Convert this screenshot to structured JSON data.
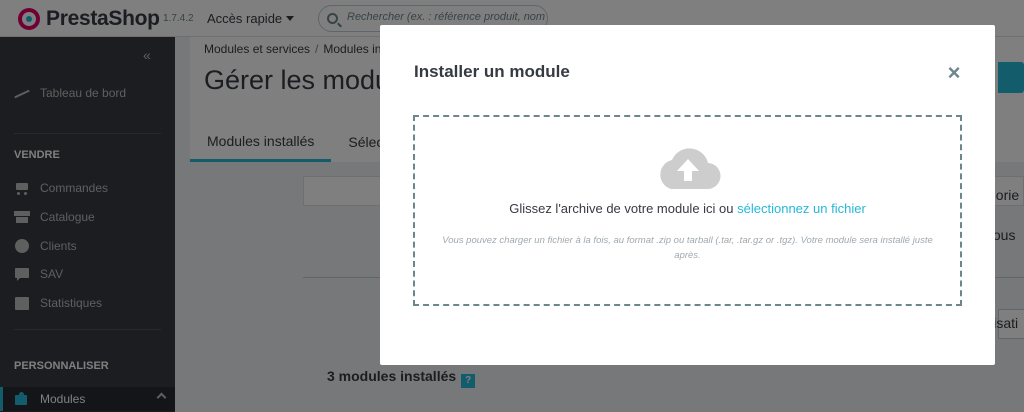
{
  "header": {
    "brand": "PrestaShop",
    "version": "1.7.4.2",
    "quick_access": "Accès rapide",
    "search_placeholder": "Rechercher (ex. : référence produit, nom"
  },
  "sidebar": {
    "collapse": "«",
    "dashboard": "Tableau de bord",
    "section_sell": "VENDRE",
    "sell_items": [
      {
        "label": "Commandes",
        "icon": "cart-icon"
      },
      {
        "label": "Catalogue",
        "icon": "store-icon"
      },
      {
        "label": "Clients",
        "icon": "person-icon"
      },
      {
        "label": "SAV",
        "icon": "chat-icon"
      },
      {
        "label": "Statistiques",
        "icon": "stats-icon"
      }
    ],
    "section_customize": "PERSONNALISER",
    "active_item": {
      "label": "Modules",
      "icon": "puzzle-icon"
    }
  },
  "main": {
    "breadcrumb": [
      "Modules et services",
      "Modules ins"
    ],
    "breadcrumb_sep": "/",
    "title": "Gérer les modul",
    "tabs": [
      {
        "label": "Modules installés",
        "active": true
      },
      {
        "label": "Sélect",
        "active": false
      }
    ],
    "right_snippets": [
      "gorie",
      "tous",
      "ilisati"
    ],
    "installed_count": "3 modules installés",
    "help": "?"
  },
  "modal": {
    "title": "Installer un module",
    "close": "×",
    "drop_text": "Glissez l'archive de votre module ici ou",
    "drop_link": "sélectionnez un fichier",
    "note": "Vous pouvez charger un fichier à la fois, au format .zip ou tarball (.tar, .tar.gz or .tgz). Votre module sera installé juste après."
  },
  "colors": {
    "accent": "#25b9d7",
    "sidebar": "#363a41",
    "brand_pink": "#df0067"
  }
}
